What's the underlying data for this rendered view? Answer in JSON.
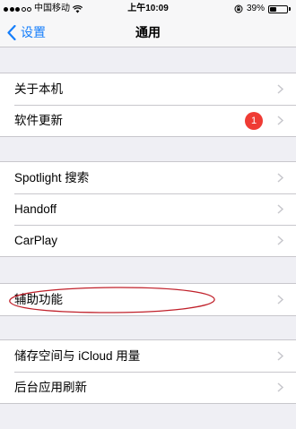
{
  "status_bar": {
    "carrier": "中国移动",
    "time": "上午10:09",
    "battery_percent_text": "39%",
    "battery_level": 0.39,
    "signal_bars_filled": 3,
    "signal_bars_total": 5
  },
  "nav": {
    "back_label": "设置",
    "title": "通用"
  },
  "groups": [
    {
      "items": [
        {
          "label": "关于本机"
        },
        {
          "label": "软件更新",
          "badge": "1"
        }
      ]
    },
    {
      "items": [
        {
          "label": "Spotlight 搜索"
        },
        {
          "label": "Handoff"
        },
        {
          "label": "CarPlay"
        }
      ]
    },
    {
      "items": [
        {
          "label": "辅助功能"
        }
      ]
    },
    {
      "items": [
        {
          "label": "储存空间与 iCloud 用量"
        },
        {
          "label": "后台应用刷新"
        }
      ]
    }
  ],
  "colors": {
    "accent": "#157efb",
    "badge": "#ef3b34",
    "annotation": "#c0202a",
    "background": "#efeff4"
  }
}
